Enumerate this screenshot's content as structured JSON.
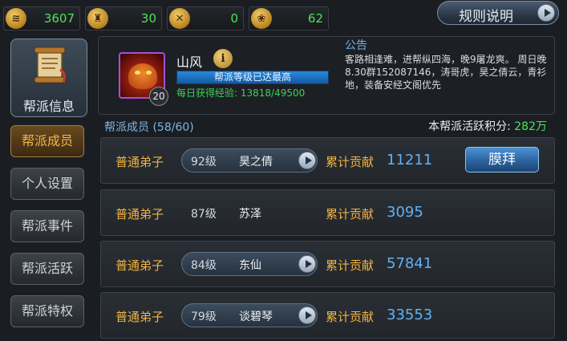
{
  "resources": [
    {
      "icon": "coin-icon",
      "glyph": "≋",
      "value": "3607"
    },
    {
      "icon": "helmet-icon",
      "glyph": "♜",
      "value": "30"
    },
    {
      "icon": "crossed-swords-icon",
      "glyph": "✕",
      "value": "0"
    },
    {
      "icon": "scroll-token-icon",
      "glyph": "❀",
      "value": "62"
    }
  ],
  "rules_button": "规则说明",
  "nav": {
    "guild_info": "帮派信息",
    "items": [
      {
        "label": "帮派成员",
        "active": true
      },
      {
        "label": "个人设置",
        "active": false
      },
      {
        "label": "帮派事件",
        "active": false
      },
      {
        "label": "帮派活跃",
        "active": false
      },
      {
        "label": "帮派特权",
        "active": false
      }
    ]
  },
  "guild": {
    "leader_name": "山风",
    "leader_level": "20",
    "info_glyph": "i",
    "level_status": "帮派等级已达最高",
    "daily_exp": "每日获得经验: 13818/49500",
    "notice_title": "公告",
    "notice_body": "客路相逢难，进帮纵四海，晚9屠龙爽。 周日晚8.30群152087146，涛哥虎，昊之倩云，青衫地，装备安经文阁优先"
  },
  "members_header": "帮派成员 (58/60)",
  "activity_label": "本帮派活跃积分:",
  "activity_value": "282万",
  "contrib_label": "累计贡献",
  "worship_label": "膜拜",
  "members": [
    {
      "rank": "普通弟子",
      "level": "92级",
      "name": "昊之倩",
      "contribution": "11211",
      "pill": true,
      "worship": true
    },
    {
      "rank": "普通弟子",
      "level": "87级",
      "name": "苏泽",
      "contribution": "3095",
      "pill": false,
      "worship": false
    },
    {
      "rank": "普通弟子",
      "level": "84级",
      "name": "东仙",
      "contribution": "57841",
      "pill": true,
      "worship": false
    },
    {
      "rank": "普通弟子",
      "level": "79级",
      "name": "谈碧琴",
      "contribution": "33553",
      "pill": true,
      "worship": false
    }
  ]
}
